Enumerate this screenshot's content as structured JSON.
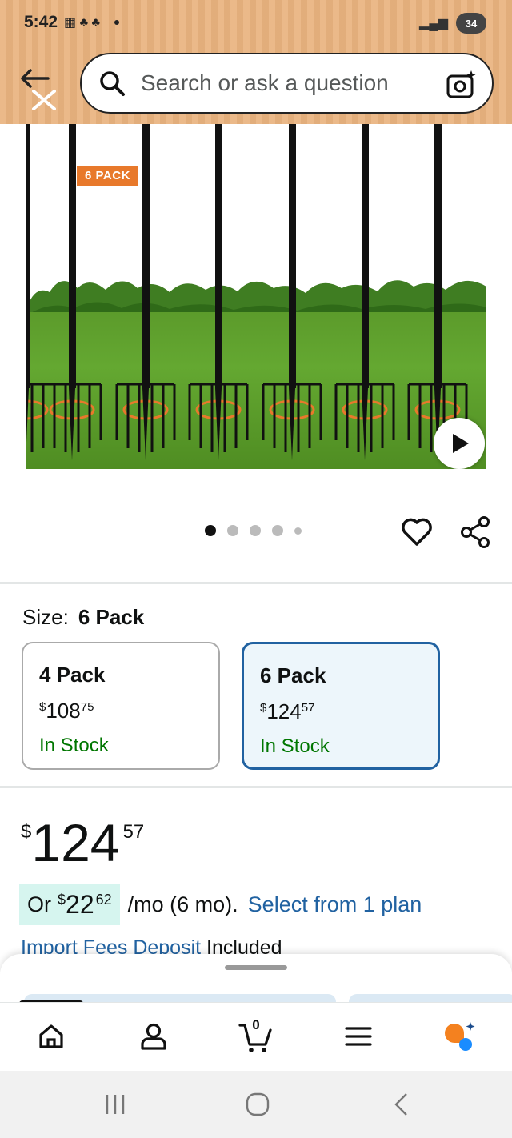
{
  "status_bar": {
    "time": "5:42",
    "battery": "34"
  },
  "header": {
    "search_placeholder": "Search or ask a question"
  },
  "product_image": {
    "badge": "6 PACK",
    "carousel_total": 5,
    "carousel_active": 1
  },
  "size_selector": {
    "label": "Size:",
    "selected_value": "6 Pack",
    "options": [
      {
        "name": "4 Pack",
        "currency": "$",
        "price_whole": "108",
        "price_fraction": "75",
        "availability": "In Stock",
        "selected": false
      },
      {
        "name": "6 Pack",
        "currency": "$",
        "price_whole": "124",
        "price_fraction": "57",
        "availability": "In Stock",
        "selected": true
      }
    ]
  },
  "pricing": {
    "currency": "$",
    "price_whole": "124",
    "price_fraction": "57",
    "monthly_prefix": "Or",
    "monthly_currency": "$",
    "monthly_whole": "22",
    "monthly_fraction": "62",
    "monthly_suffix": "/mo (6 mo).",
    "plan_link": "Select from 1 plan",
    "fees_link": "Import Fees Deposit",
    "fees_status": "Included"
  },
  "bottom_nav": {
    "cart_count": "0"
  },
  "colors": {
    "header_bg": "#e9b37f",
    "link": "#2162a1",
    "in_stock": "#007600",
    "selected_border": "#2162a1",
    "badge": "#e8792b"
  }
}
